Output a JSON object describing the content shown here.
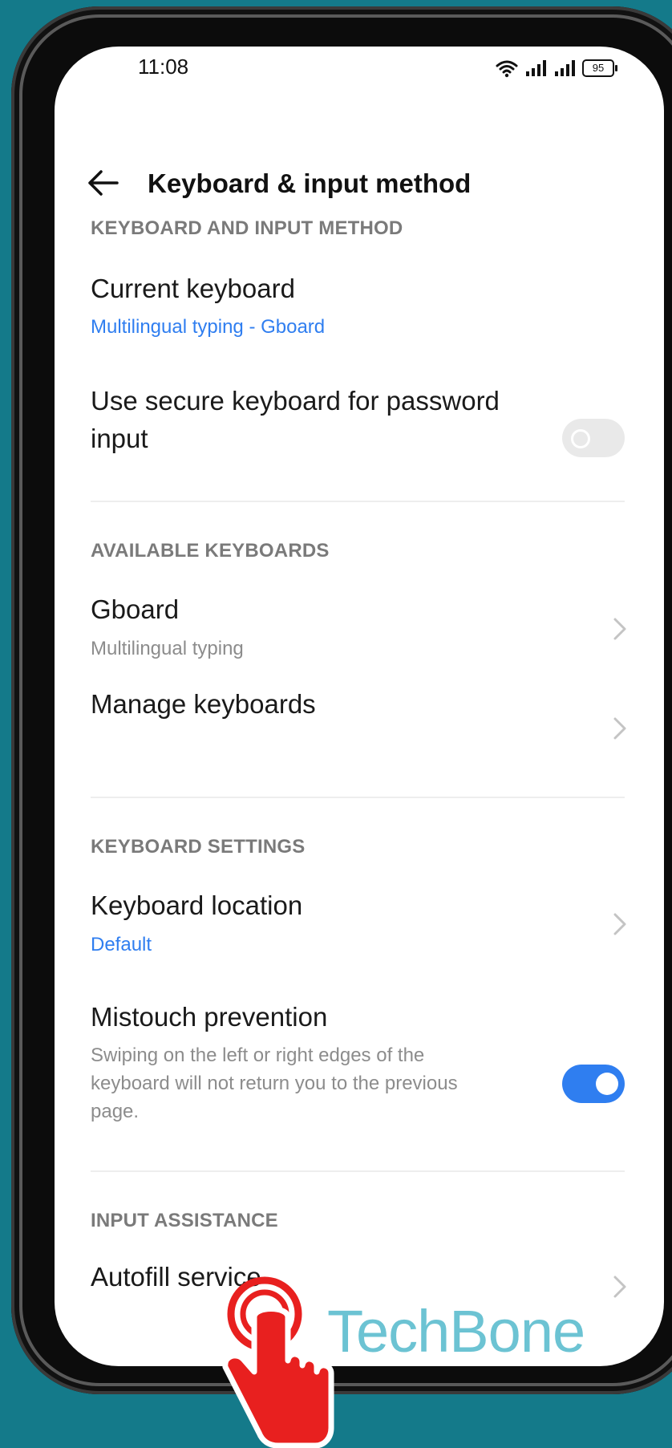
{
  "status_bar": {
    "time": "11:08",
    "battery": "95"
  },
  "header": {
    "title": "Keyboard & input method"
  },
  "sections": {
    "keyboard_input": {
      "label": "KEYBOARD AND INPUT METHOD",
      "current_keyboard": {
        "title": "Current keyboard",
        "value": "Multilingual typing - Gboard"
      },
      "secure_keyboard": {
        "title": "Use secure keyboard for password input",
        "enabled": false
      }
    },
    "available_keyboards": {
      "label": "AVAILABLE KEYBOARDS",
      "gboard": {
        "title": "Gboard",
        "subtitle": "Multilingual typing"
      },
      "manage": {
        "title": "Manage keyboards"
      }
    },
    "keyboard_settings": {
      "label": "KEYBOARD SETTINGS",
      "location": {
        "title": "Keyboard location",
        "value": "Default"
      },
      "mistouch": {
        "title": "Mistouch prevention",
        "description": "Swiping on the left or right edges of the keyboard will not return you to the previous page.",
        "enabled": true
      }
    },
    "input_assistance": {
      "label": "INPUT ASSISTANCE",
      "autofill": {
        "title": "Autofill service"
      }
    }
  },
  "watermark": "TechBone",
  "icons": {
    "back": "arrow-left-icon",
    "chevron": "chevron-right-icon",
    "wifi": "wifi-icon",
    "signal": "signal-icon",
    "battery": "battery-icon",
    "tap": "tap-hand-icon"
  },
  "colors": {
    "background": "#147a8a",
    "accent": "#2f7ef0",
    "toggle_off": "#e9e9e9",
    "watermark": "#6cc3d3",
    "tap_hand": "#e8201f"
  }
}
